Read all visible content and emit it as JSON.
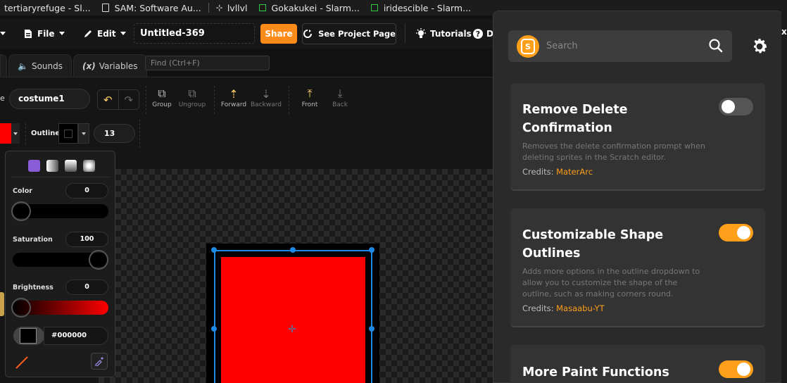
{
  "bookmarks": [
    {
      "label": "tertiaryrefuge - Sl...",
      "icon": "none"
    },
    {
      "label": "SAM: Software Au...",
      "icon": "doc"
    },
    {
      "label": "lvllvl",
      "icon": "grid"
    },
    {
      "label": "Gokakukei - Slarm...",
      "icon": "square"
    },
    {
      "label": "iridescible - Slarm...",
      "icon": "square"
    }
  ],
  "menu": {
    "file_label": "File",
    "edit_label": "Edit",
    "project_title": "Untitled-369",
    "share_label": "Share",
    "see_project_label": "See Project Page",
    "tutorials_label": "Tutorials",
    "debug_label": "D"
  },
  "tabs": {
    "sounds_label": "Sounds",
    "variables_label": "Variables",
    "variables_icon_text": "(x)",
    "find_placeholder": "Find (Ctrl+F)"
  },
  "paint": {
    "costume_label": "e",
    "costume_name": "costume1",
    "tools": {
      "group": "Group",
      "ungroup": "Ungroup",
      "forward": "Forward",
      "backward": "Backward",
      "front": "Front",
      "back": "Back"
    },
    "outline_label": "Outline",
    "outline_size": "13",
    "fill_color": "#ff0000"
  },
  "color_popover": {
    "color_label": "Color",
    "color_value": "0",
    "saturation_label": "Saturation",
    "saturation_value": "100",
    "brightness_label": "Brightness",
    "brightness_value": "0",
    "hex_value": "#000000"
  },
  "addons": {
    "search_placeholder": "Search",
    "accent": "#ff9f1a",
    "logo_letter": "S",
    "credits_prefix": "Credits:",
    "cards": [
      {
        "title": "Remove Delete Confirmation",
        "description": "Removes the delete confirmation prompt when deleting sprites in the Scratch editor.",
        "credit": "MaterArc",
        "enabled": false
      },
      {
        "title": "Customizable Shape Outlines",
        "description": "Adds more options in the outline dropdown to allow you to customize the shape of the outline, such as making corners round.",
        "credit": "Masaabu-YT",
        "enabled": true
      },
      {
        "title": "More Paint Functions",
        "enabled": true
      }
    ]
  },
  "ext_close_text": "x"
}
